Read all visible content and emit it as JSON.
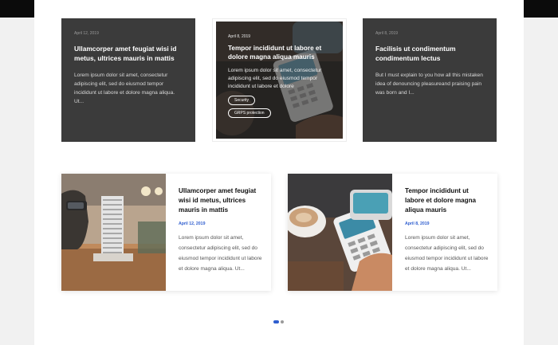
{
  "top_cards": [
    {
      "date": "April 12, 2019",
      "title": "Ullamcorper amet feugiat wisi id metus, ultrices mauris in mattis",
      "excerpt": "Lorem ipsum dolor sit amet, consectetur adipiscing elit, sed do eiusmod tempor incididunt ut labore et dolore magna aliqua. Ut..."
    },
    {
      "date": "April 8, 2019",
      "title": "Tempor incididunt ut labore et dolore magna aliqua mauris",
      "excerpt": "Lorem ipsum dolor sit amet, consectetur adipiscing elit, sed do eiusmod tempor incididunt ut labore et dolore",
      "tags": [
        "Security",
        "GRPS protection"
      ]
    },
    {
      "date": "April 8, 2019",
      "title": "Facilisis ut condimentum condimentum lectus",
      "excerpt": "But I must explain to you how all this mistaken idea of denouncing pleasureand praising pain was born and I..."
    }
  ],
  "bottom_cards": [
    {
      "title": "Ullamcorper amet feugiat wisi id metus, ultrices mauris in mattis",
      "date": "April 12, 2019",
      "excerpt": "Lorem ipsum dolor sit amet, consectetur adipiscing elit, sed do eiusmod tempor incididunt ut labore et dolore magna aliqua. Ut..."
    },
    {
      "title": "Tempor incididunt ut labore et dolore magna aliqua mauris",
      "date": "April 8, 2019",
      "excerpt": "Lorem ipsum dolor sit amet, consectetur adipiscing elit, sed do eiusmod tempor incididunt ut labore et dolore magna aliqua. Ut..."
    }
  ],
  "pagination": {
    "active_index": 0,
    "count": 2
  },
  "colors": {
    "accent": "#2f5ecf",
    "dark_card": "#3b3b3b",
    "top_bar": "#0b0b0b"
  }
}
